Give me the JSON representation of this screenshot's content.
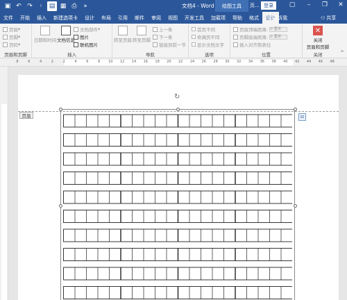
{
  "titlebar": {
    "doc_title": "文档4 - Word",
    "context_label": "绘图工具",
    "context_lang": "页...",
    "login": "登录",
    "qat_icons": [
      "save-icon",
      "undo-icon",
      "redo-icon",
      "layout-icon",
      "table-icon",
      "print-icon",
      "more-icon"
    ]
  },
  "tabs": [
    {
      "label": "文件",
      "active": false
    },
    {
      "label": "开始",
      "active": false
    },
    {
      "label": "插入",
      "active": false
    },
    {
      "label": "新建选项卡",
      "active": false
    },
    {
      "label": "设计",
      "active": false
    },
    {
      "label": "布局",
      "active": false
    },
    {
      "label": "引用",
      "active": false
    },
    {
      "label": "邮件",
      "active": false
    },
    {
      "label": "审阅",
      "active": false
    },
    {
      "label": "视图",
      "active": false
    },
    {
      "label": "开发工具",
      "active": false
    },
    {
      "label": "加载项",
      "active": false
    },
    {
      "label": "帮助",
      "active": false
    },
    {
      "label": "格式",
      "active": false
    },
    {
      "label": "设计",
      "active": true
    }
  ],
  "tell_me": "告诉我",
  "share": "共享",
  "ribbon": {
    "hf_group": {
      "items": [
        "页眉",
        "页脚",
        "页码"
      ],
      "label": "页眉和页脚"
    },
    "insert_group": {
      "date_time": "日期和时间",
      "doc_info": "文档信息",
      "doc_parts": "文档部件",
      "picture": "图片",
      "online_picture": "联机图片",
      "label": "插入"
    },
    "nav_group": {
      "goto_header": "转至页眉",
      "goto_footer": "转至页脚",
      "previous": "上一条",
      "next": "下一条",
      "link_previous": "链接到前一节",
      "label": "导航"
    },
    "options_group": {
      "first_page": "首页不同",
      "odd_even": "奇偶页不同",
      "show_text": "显示文档文字",
      "label": "选项"
    },
    "position_group": {
      "header_top": "页眉顶端距离:",
      "footer_bottom": "页脚底端距离:",
      "header_val": "0 厘米",
      "footer_val": "0 厘米",
      "align_tab": "插入对齐制表位",
      "label": "位置"
    },
    "close_group": {
      "close": "关闭",
      "close2": "页眉和页脚",
      "label": "关闭"
    }
  },
  "ruler": {
    "numbers": [
      "8",
      "6",
      "4",
      "2",
      "2",
      "4",
      "6",
      "8",
      "10",
      "12",
      "14",
      "16",
      "18",
      "20",
      "22",
      "24",
      "26",
      "28",
      "30",
      "32",
      "34",
      "36",
      "38",
      "40",
      "42",
      "44",
      "46",
      "48"
    ]
  },
  "header_tag": "页眉"
}
